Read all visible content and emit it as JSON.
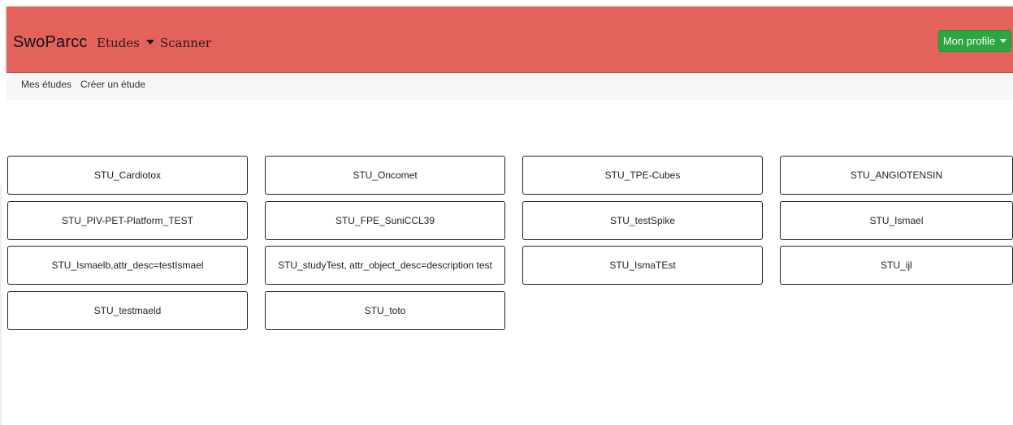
{
  "header": {
    "brand": "SwoParcc",
    "nav": [
      {
        "label": "Etudes"
      },
      {
        "label": "Scanner"
      }
    ],
    "profile_label": "Mon profile"
  },
  "subnav": {
    "items": [
      "Mes études",
      "Créer un étude"
    ]
  },
  "studies": [
    "STU_Cardiotox",
    "STU_Oncomet",
    "STU_TPE-Cubes",
    "STU_ANGIOTENSIN",
    "STU_PIV-PET-Platform_TEST",
    "STU_FPE_SuniCCL39",
    "STU_testSpike",
    "STU_Ismael",
    "STU_Ismaelb,attr_desc=testIsmael",
    "STU_studyTest, attr_object_desc=description test",
    "STU_IsmaTEst",
    "STU_ijl",
    "STU_testmaeld",
    "STU_toto"
  ],
  "colors": {
    "navbar": "#e3625c",
    "profile_button": "#2aa83f"
  }
}
